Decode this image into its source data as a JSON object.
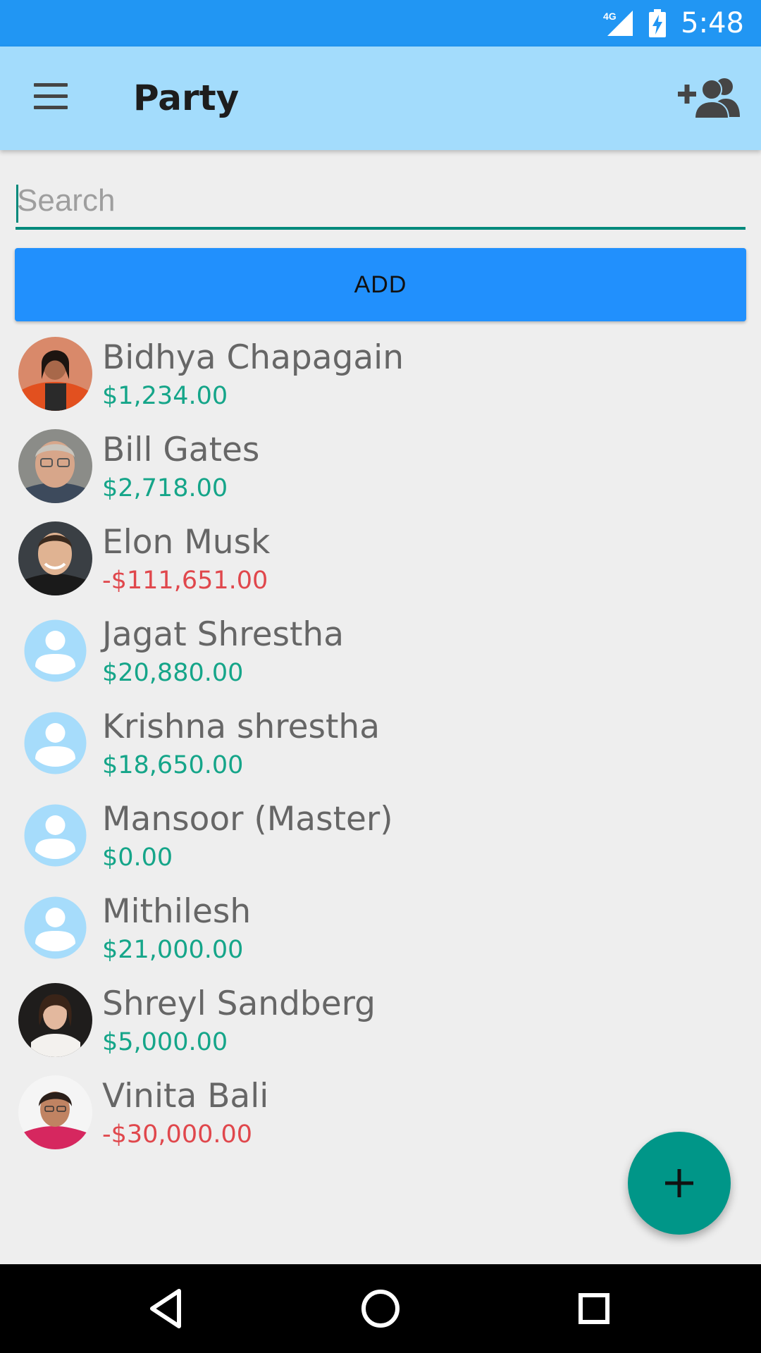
{
  "status_bar": {
    "time": "5:48",
    "network": "4G"
  },
  "app_bar": {
    "title": "Party"
  },
  "search": {
    "placeholder": "Search",
    "value": ""
  },
  "add_button": {
    "label": "ADD"
  },
  "colors": {
    "positive": "#15a589",
    "negative": "#e0474c",
    "accent": "#009688",
    "primary": "#2196f3"
  },
  "parties": [
    {
      "name": "Bidhya Chapagain",
      "amount": "$1,234.00",
      "negative": false,
      "avatar": "photo"
    },
    {
      "name": "Bill Gates",
      "amount": "$2,718.00",
      "negative": false,
      "avatar": "photo"
    },
    {
      "name": "Elon Musk",
      "amount": "-$111,651.00",
      "negative": true,
      "avatar": "photo"
    },
    {
      "name": "Jagat Shrestha",
      "amount": "$20,880.00",
      "negative": false,
      "avatar": "placeholder-person-icon"
    },
    {
      "name": "Krishna shrestha",
      "amount": "$18,650.00",
      "negative": false,
      "avatar": "placeholder-person-icon"
    },
    {
      "name": "Mansoor (Master)",
      "amount": "$0.00",
      "negative": false,
      "avatar": "placeholder-person-icon"
    },
    {
      "name": "Mithilesh",
      "amount": "$21,000.00",
      "negative": false,
      "avatar": "placeholder-person-icon"
    },
    {
      "name": "Shreyl Sandberg",
      "amount": "$5,000.00",
      "negative": false,
      "avatar": "photo"
    },
    {
      "name": "Vinita Bali",
      "amount": "-$30,000.00",
      "negative": true,
      "avatar": "photo"
    }
  ]
}
